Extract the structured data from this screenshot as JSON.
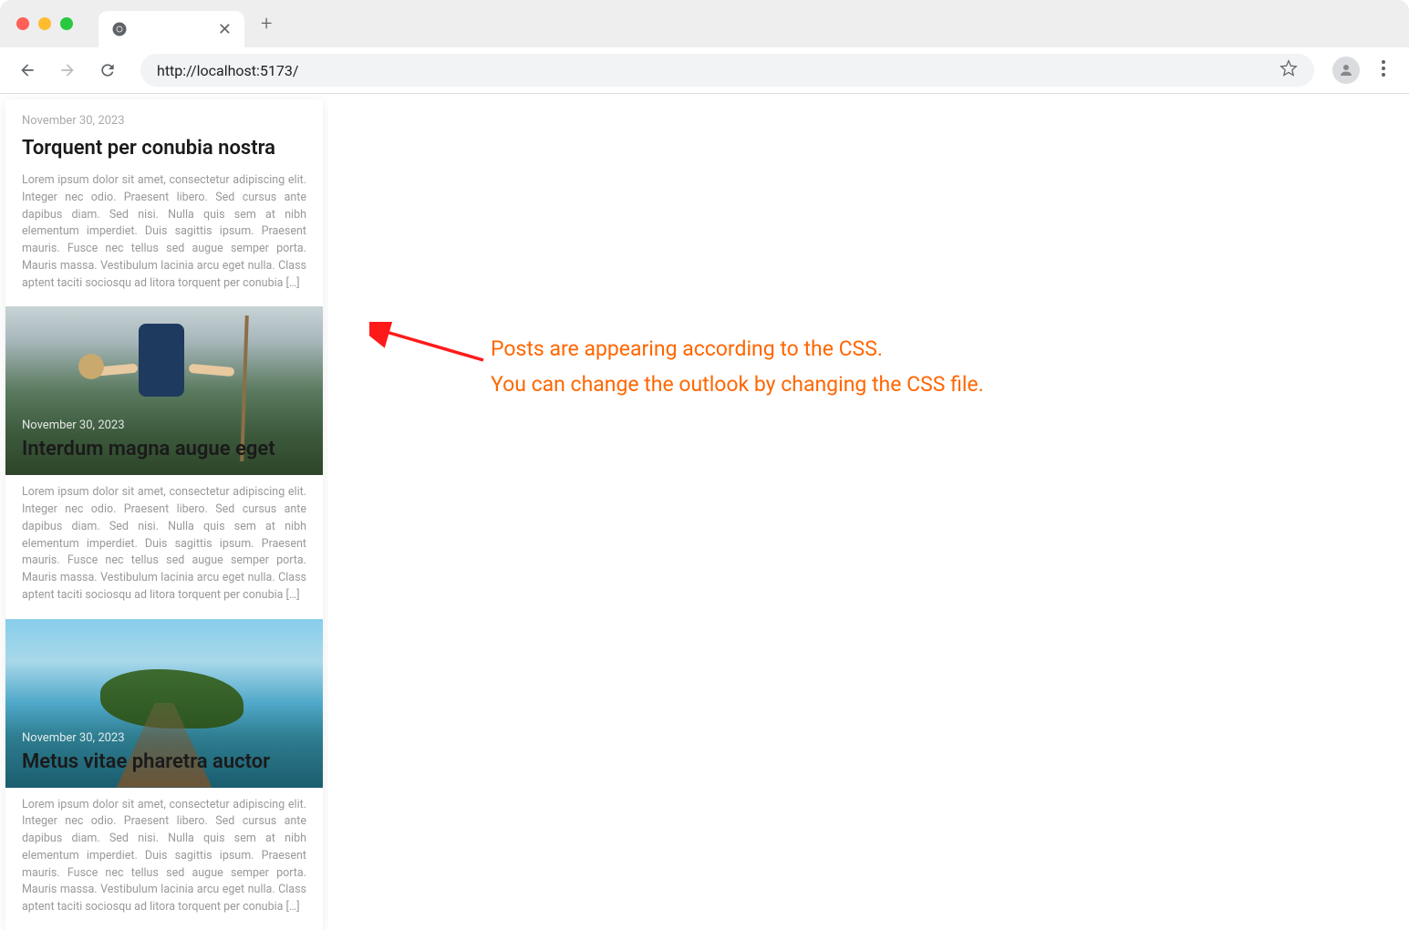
{
  "browser": {
    "url": "http://localhost:5173/",
    "tab_title": ""
  },
  "posts": [
    {
      "date": "November 30, 2023",
      "title": "Torquent per conubia nostra",
      "excerpt": "Lorem ipsum dolor sit amet, consectetur adipiscing elit. Integer nec odio. Praesent libero. Sed cursus ante dapibus diam. Sed nisi. Nulla quis sem at nibh elementum imperdiet. Duis sagittis ipsum. Praesent mauris. Fusce nec tellus sed augue semper porta. Mauris massa. Vestibulum lacinia arcu eget nulla. Class aptent taciti sociosqu ad litora torquent per conubia […]"
    },
    {
      "date": "November 30, 2023",
      "title": "Interdum magna augue eget",
      "excerpt": "Lorem ipsum dolor sit amet, consectetur adipiscing elit. Integer nec odio. Praesent libero. Sed cursus ante dapibus diam. Sed nisi. Nulla quis sem at nibh elementum imperdiet. Duis sagittis ipsum. Praesent mauris. Fusce nec tellus sed augue semper porta. Mauris massa. Vestibulum lacinia arcu eget nulla. Class aptent taciti sociosqu ad litora torquent per conubia […]"
    },
    {
      "date": "November 30, 2023",
      "title": "Metus vitae pharetra auctor",
      "excerpt": "Lorem ipsum dolor sit amet, consectetur adipiscing elit. Integer nec odio. Praesent libero. Sed cursus ante dapibus diam. Sed nisi. Nulla quis sem at nibh elementum imperdiet. Duis sagittis ipsum. Praesent mauris. Fusce nec tellus sed augue semper porta. Mauris massa. Vestibulum lacinia arcu eget nulla. Class aptent taciti sociosqu ad litora torquent per conubia […]"
    }
  ],
  "annotation": {
    "line1": "Posts are appearing according to the CSS.",
    "line2": "You can change the outlook by changing the CSS file."
  }
}
